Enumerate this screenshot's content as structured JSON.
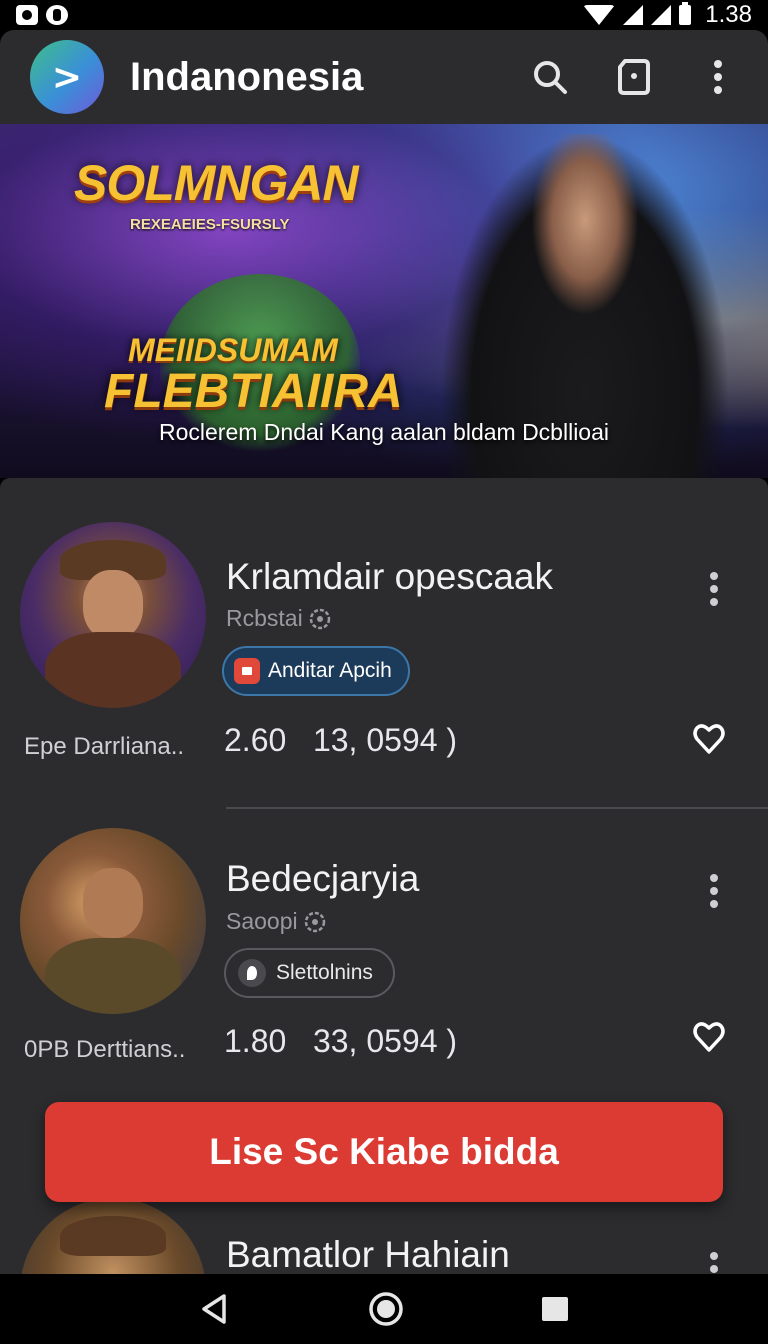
{
  "status_bar": {
    "time": "1.38"
  },
  "app_bar": {
    "logo_glyph": ">",
    "title": "Indanonesia"
  },
  "banner": {
    "title": "SOLMNGAN",
    "subtitle": "REXEAEIES-FSURSLY",
    "mid_line_1": "MEIIDSUMAM",
    "mid_line_2": "FLEBTIAIIRA",
    "caption": "Roclerem Dndai Kang aalan bldam Dcbllioai"
  },
  "cards": [
    {
      "title": "Krlamdair opescaak",
      "subtitle": "Rcbstai",
      "tag_label": "Anditar Apcih",
      "left_text": "Epe Darrliana..",
      "stat_value": "2.60",
      "stat_count": "13, 0594 )"
    },
    {
      "title": "Bedecjaryia",
      "subtitle": "Saoopi",
      "tag_label": "Slettolnins",
      "left_text": "0PB Derttians..",
      "stat_value": "1.80",
      "stat_count": "33, 0594 )"
    },
    {
      "title": "Bamatlor Hahiain"
    }
  ],
  "cta": {
    "label": "Lise Sc Kiabe bidda"
  },
  "colors": {
    "app_bar_bg": "#2c2c2f",
    "cta_bg": "#dc3b34",
    "tag_primary_bg": "#1c3a5a",
    "tag_primary_border": "#3d77a8",
    "banner_gold": "#f6c233"
  },
  "icons": {
    "app_bar": [
      "search-icon",
      "save-icon",
      "more-vert-icon"
    ],
    "nav_bar": [
      "back-icon",
      "home-icon",
      "recents-icon"
    ]
  }
}
